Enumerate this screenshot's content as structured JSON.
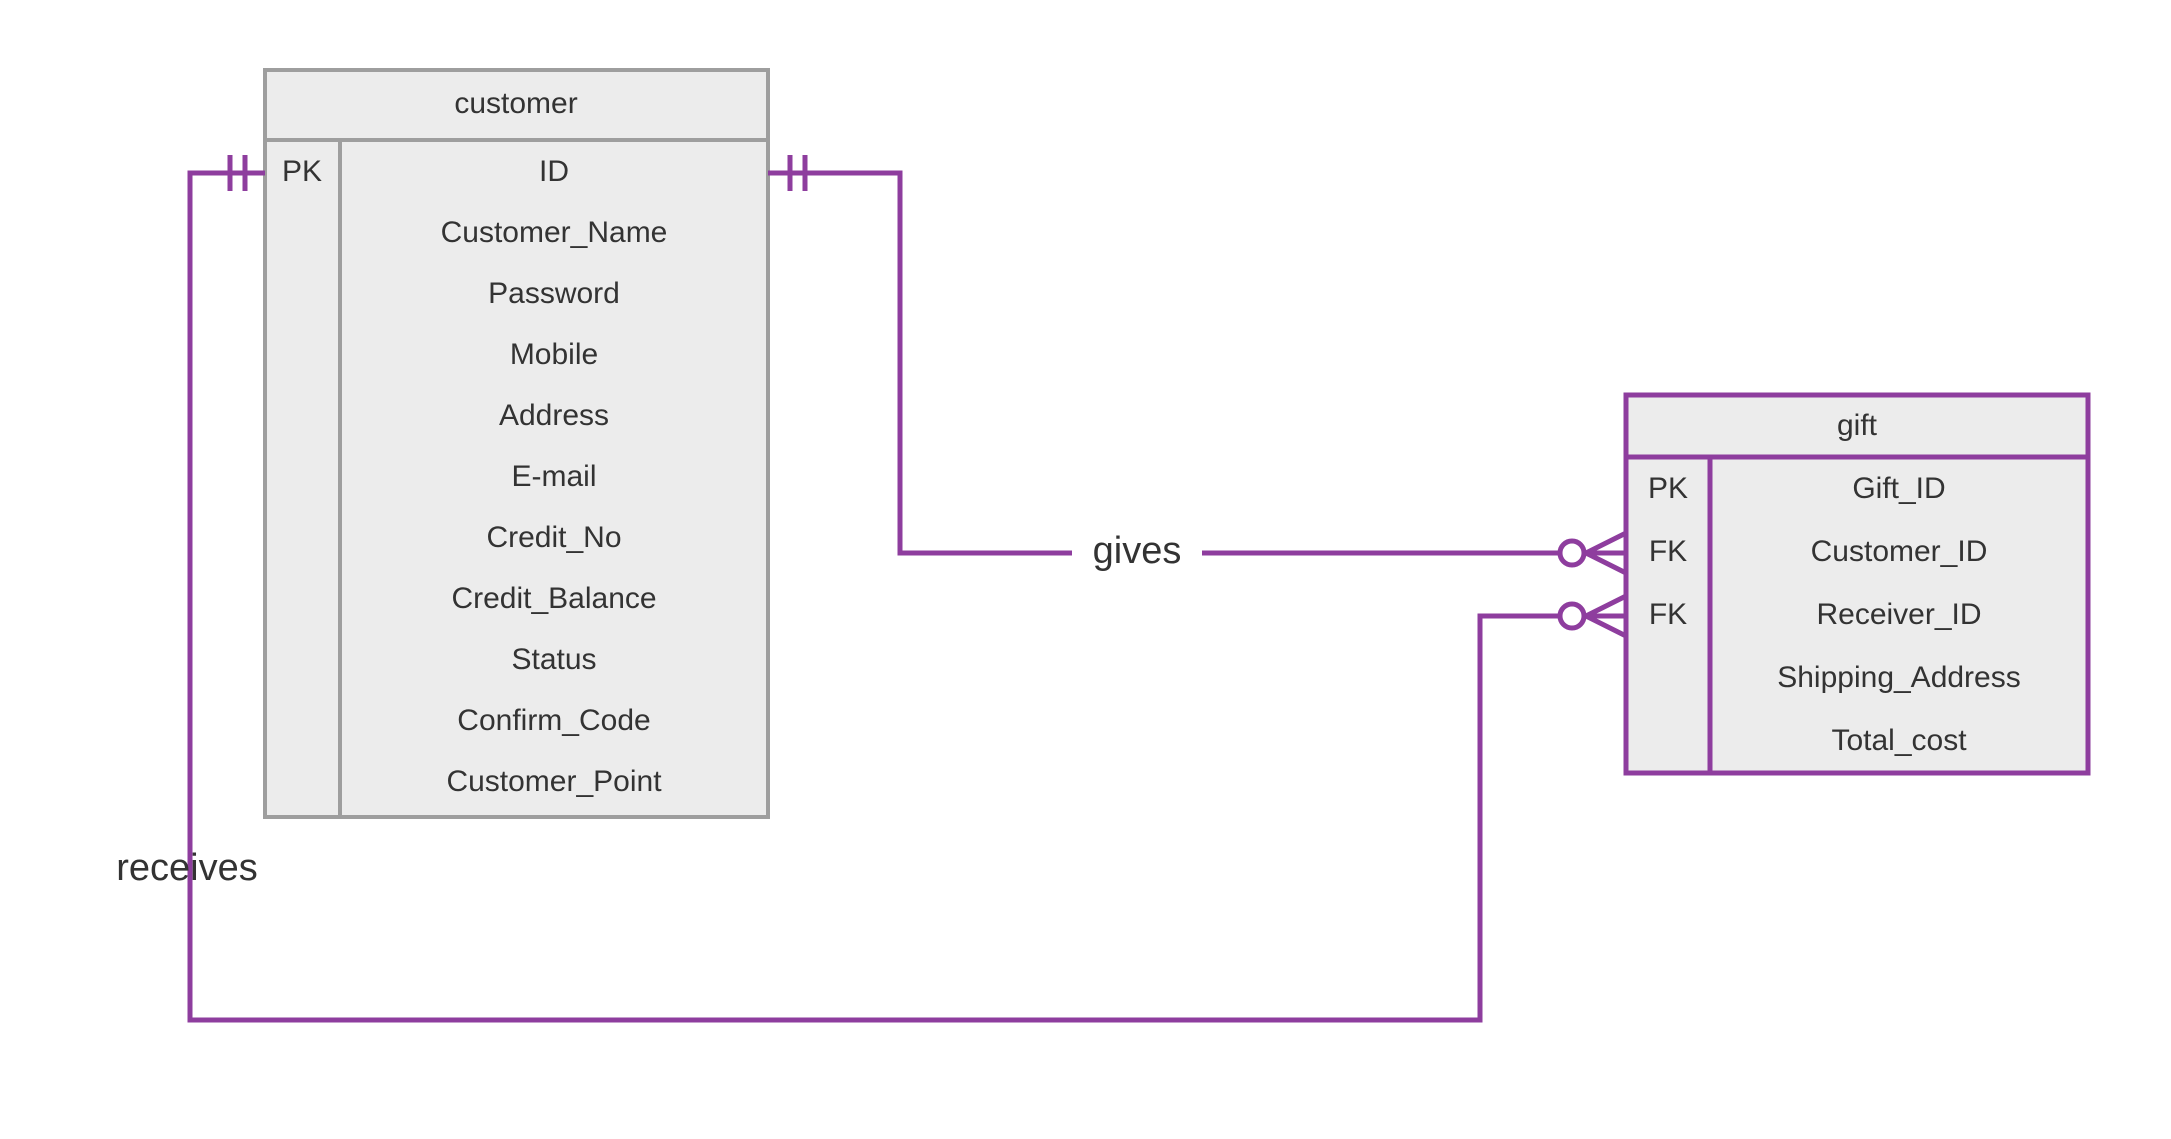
{
  "entities": {
    "customer": {
      "title": "customer",
      "keys": [
        "PK",
        "",
        "",
        "",
        "",
        "",
        "",
        "",
        "",
        "",
        ""
      ],
      "attributes": [
        "ID",
        "Customer_Name",
        "Password",
        "Mobile",
        "Address",
        "E-mail",
        "Credit_No",
        "Credit_Balance",
        "Status",
        "Confirm_Code",
        "Customer_Point"
      ]
    },
    "gift": {
      "title": "gift",
      "keys": [
        "PK",
        "FK",
        "FK",
        "",
        ""
      ],
      "attributes": [
        "Gift_ID",
        "Customer_ID",
        "Receiver_ID",
        "Shipping_Address",
        "Total_cost"
      ]
    }
  },
  "relationships": {
    "gives": {
      "label": "gives"
    },
    "receives": {
      "label": "receives"
    }
  },
  "colors": {
    "entityFill": "#ececec",
    "customerBorder": "#9e9e9e",
    "giftBorder": "#8e3d9e",
    "line": "#8e3d9e"
  }
}
